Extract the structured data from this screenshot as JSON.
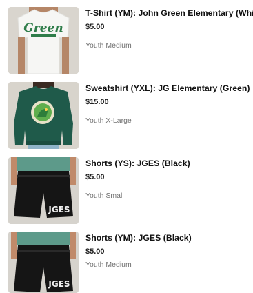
{
  "products": [
    {
      "title": "T-Shirt (YM): John Green Elementary (White)",
      "price": "$5.00",
      "size": "Youth Medium",
      "image": "white-tshirt-photo",
      "print": "Green"
    },
    {
      "title": "Sweatshirt (YXL): JG Elementary (Green)",
      "price": "$15.00",
      "size": "Youth X-Large",
      "image": "green-sweatshirt-photo"
    },
    {
      "title": "Shorts (YS): JGES (Black)",
      "price": "$5.00",
      "size": "Youth Small",
      "image": "black-shorts-photo",
      "print": "JGES"
    },
    {
      "title": "Shorts (YM): JGES (Black)",
      "price": "$5.00",
      "size": "Youth Medium",
      "image": "black-shorts-photo",
      "print": "JGES"
    }
  ],
  "colors": {
    "tshirt": "#f6f6f4",
    "tshirt_print": "#2f7d4a",
    "sweatshirt": "#1f5a4a",
    "shorts": "#151515",
    "top_teal": "#5d9a8a",
    "skin": "#c08a6a",
    "wall": "#d9d5ce"
  }
}
